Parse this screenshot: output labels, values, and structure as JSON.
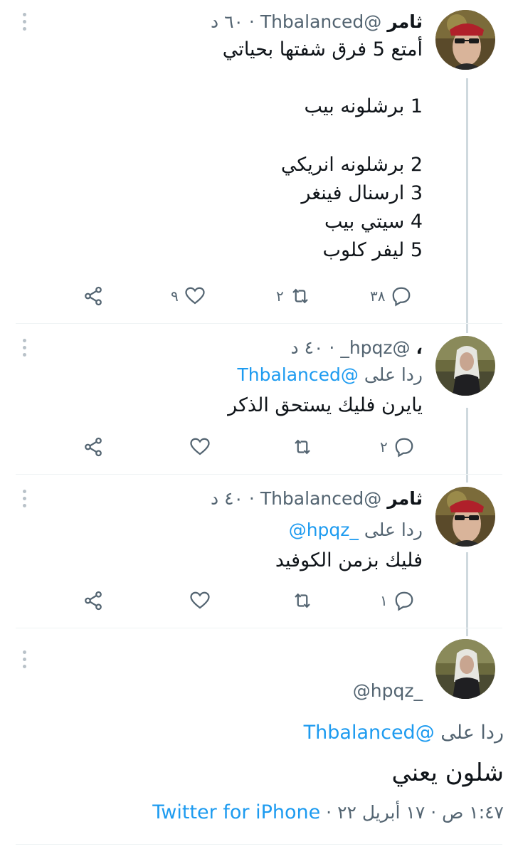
{
  "colors": {
    "link": "#1d9bf0",
    "muted": "#536471",
    "text": "#0f1419",
    "thread_line": "#cfd9de"
  },
  "tweets": [
    {
      "name": "ثامر",
      "handle": "@Thbalanced",
      "time": "· ٦٠ د",
      "lines": [
        "أمتع 5 فرق شفتها بحياتي",
        "",
        "1 برشلونه بيب",
        "",
        "2 برشلونه انريكي",
        "3 ارسنال فينغر",
        "4 سيتي بيب",
        "5 ليفر كلوب"
      ],
      "replies": "٣٨",
      "retweets": "٢",
      "likes": "٩"
    },
    {
      "name": "،",
      "handle": "@hpqz_",
      "time": "· ٤٠ د",
      "replying_prefix": "ردا على",
      "replying_to": "@Thbalanced",
      "text": "يايرن فليك يستحق الذكر",
      "replies": "٢"
    },
    {
      "name": "ثامر",
      "handle": "@Thbalanced",
      "time": "· ٤٠ د",
      "replying_prefix": "ردا على",
      "replying_to": "_hpqz@",
      "text": "فليك بزمن الكوفيد",
      "replies": "١"
    }
  ],
  "focused": {
    "handle": "_hpqz@",
    "replying_prefix": "ردا على",
    "replying_to": "@Thbalanced",
    "text": "شلون يعني",
    "timestamp": "١:٤٧ ص · ١٧ أبريل ٢٢ ·",
    "source": "Twitter for iPhone"
  },
  "icons": [
    "share-icon",
    "like-icon",
    "retweet-icon",
    "reply-icon",
    "more-icon",
    "verified-icon"
  ]
}
